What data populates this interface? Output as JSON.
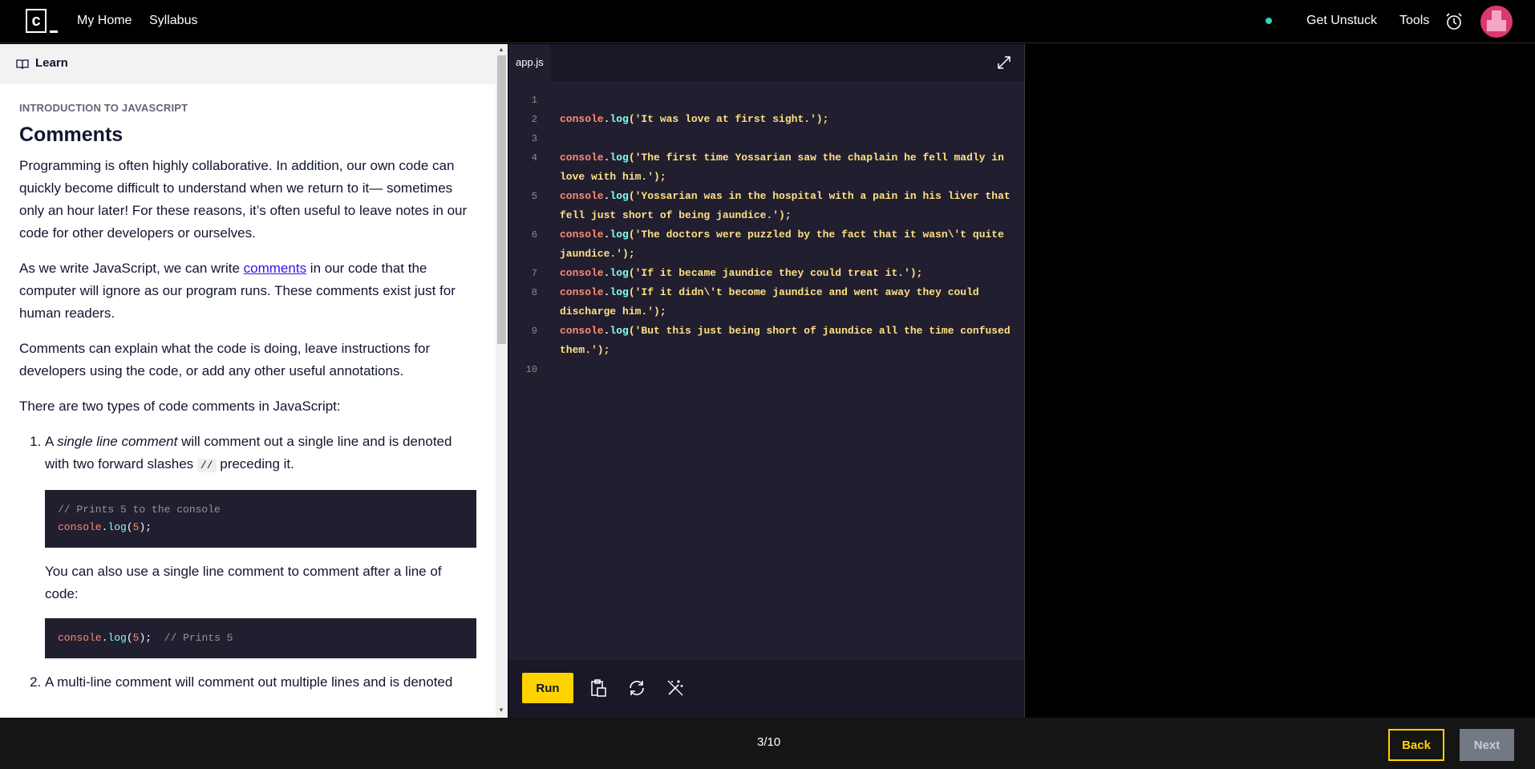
{
  "nav": {
    "logo_letter": "c",
    "my_home": "My Home",
    "syllabus": "Syllabus",
    "get_unstuck": "Get Unstuck",
    "tools": "Tools"
  },
  "learn": {
    "header": "Learn",
    "kicker": "INTRODUCTION TO JAVASCRIPT",
    "title": "Comments",
    "p1": "Programming is often highly collaborative. In addition, our own code can quickly become difficult to understand when we return to it— sometimes only an hour later! For these reasons, it’s often useful to leave notes in our code for other developers or ourselves.",
    "p2_before": "As we write JavaScript, we can write ",
    "p2_link": "comments",
    "p2_after": " in our code that the computer will ignore as our program runs. These comments exist just for human readers.",
    "p3": "Comments can explain what the code is doing, leave instructions for developers using the code, or add any other useful annotations.",
    "p4": "There are two types of code comments in JavaScript:",
    "item1_a": "A ",
    "item1_em": "single line comment",
    "item1_b": " will comment out a single line and is denoted with two forward slashes ",
    "item1_code": "//",
    "item1_c": " preceding it.",
    "block1_comment": "// Prints 5 to the console",
    "block1_obj": "console",
    "block1_dot": ".",
    "block1_fn": "log",
    "block1_open": "(",
    "block1_num": "5",
    "block1_close": ");",
    "p5": "You can also use a single line comment to comment after a line of code:",
    "block2_obj": "console",
    "block2_dot": ".",
    "block2_fn": "log",
    "block2_open": "(",
    "block2_num": "5",
    "block2_close": ");",
    "block2_comment": "  // Prints 5",
    "item2_partial": "A multi-line comment will comment out multiple lines and is denoted"
  },
  "editor": {
    "tab": "app.js",
    "line_numbers": [
      "1",
      "2",
      "3",
      "4",
      "5",
      "6",
      "7",
      "8",
      "9",
      "10"
    ],
    "lines": [
      {
        "n": "2",
        "obj": "console",
        "fn": "log",
        "str": "('It was love at first sight.');"
      },
      {
        "n": "4",
        "obj": "console",
        "fn": "log",
        "str": "('The first time Yossarian saw the chaplain he fell madly in love with him.');"
      },
      {
        "n": "5",
        "obj": "console",
        "fn": "log",
        "str": "('Yossarian was in the hospital with a pain in his liver that fell just short of being jaundice.');"
      },
      {
        "n": "6",
        "obj": "console",
        "fn": "log",
        "str": "('The doctors were puzzled by the fact that it wasn\\'t quite jaundice.');"
      },
      {
        "n": "7",
        "obj": "console",
        "fn": "log",
        "str": "('If it became jaundice they could treat it.');"
      },
      {
        "n": "8",
        "obj": "console",
        "fn": "log",
        "str": "('If it didn\\'t become jaundice and went away they could discharge him.');"
      },
      {
        "n": "9",
        "obj": "console",
        "fn": "log",
        "str": "('But this just being short of jaundice all the time confused them.');"
      }
    ],
    "run_label": "Run",
    "tool_icons": [
      "clipboard-icon",
      "refresh-icon",
      "magic-wand-icon"
    ]
  },
  "footer": {
    "progress": "3/10",
    "back": "Back",
    "next": "Next"
  },
  "colors": {
    "accent": "#ffd300",
    "link": "#3a10e5",
    "editor_bg": "#211e2f",
    "status": "#2ad6c0"
  }
}
